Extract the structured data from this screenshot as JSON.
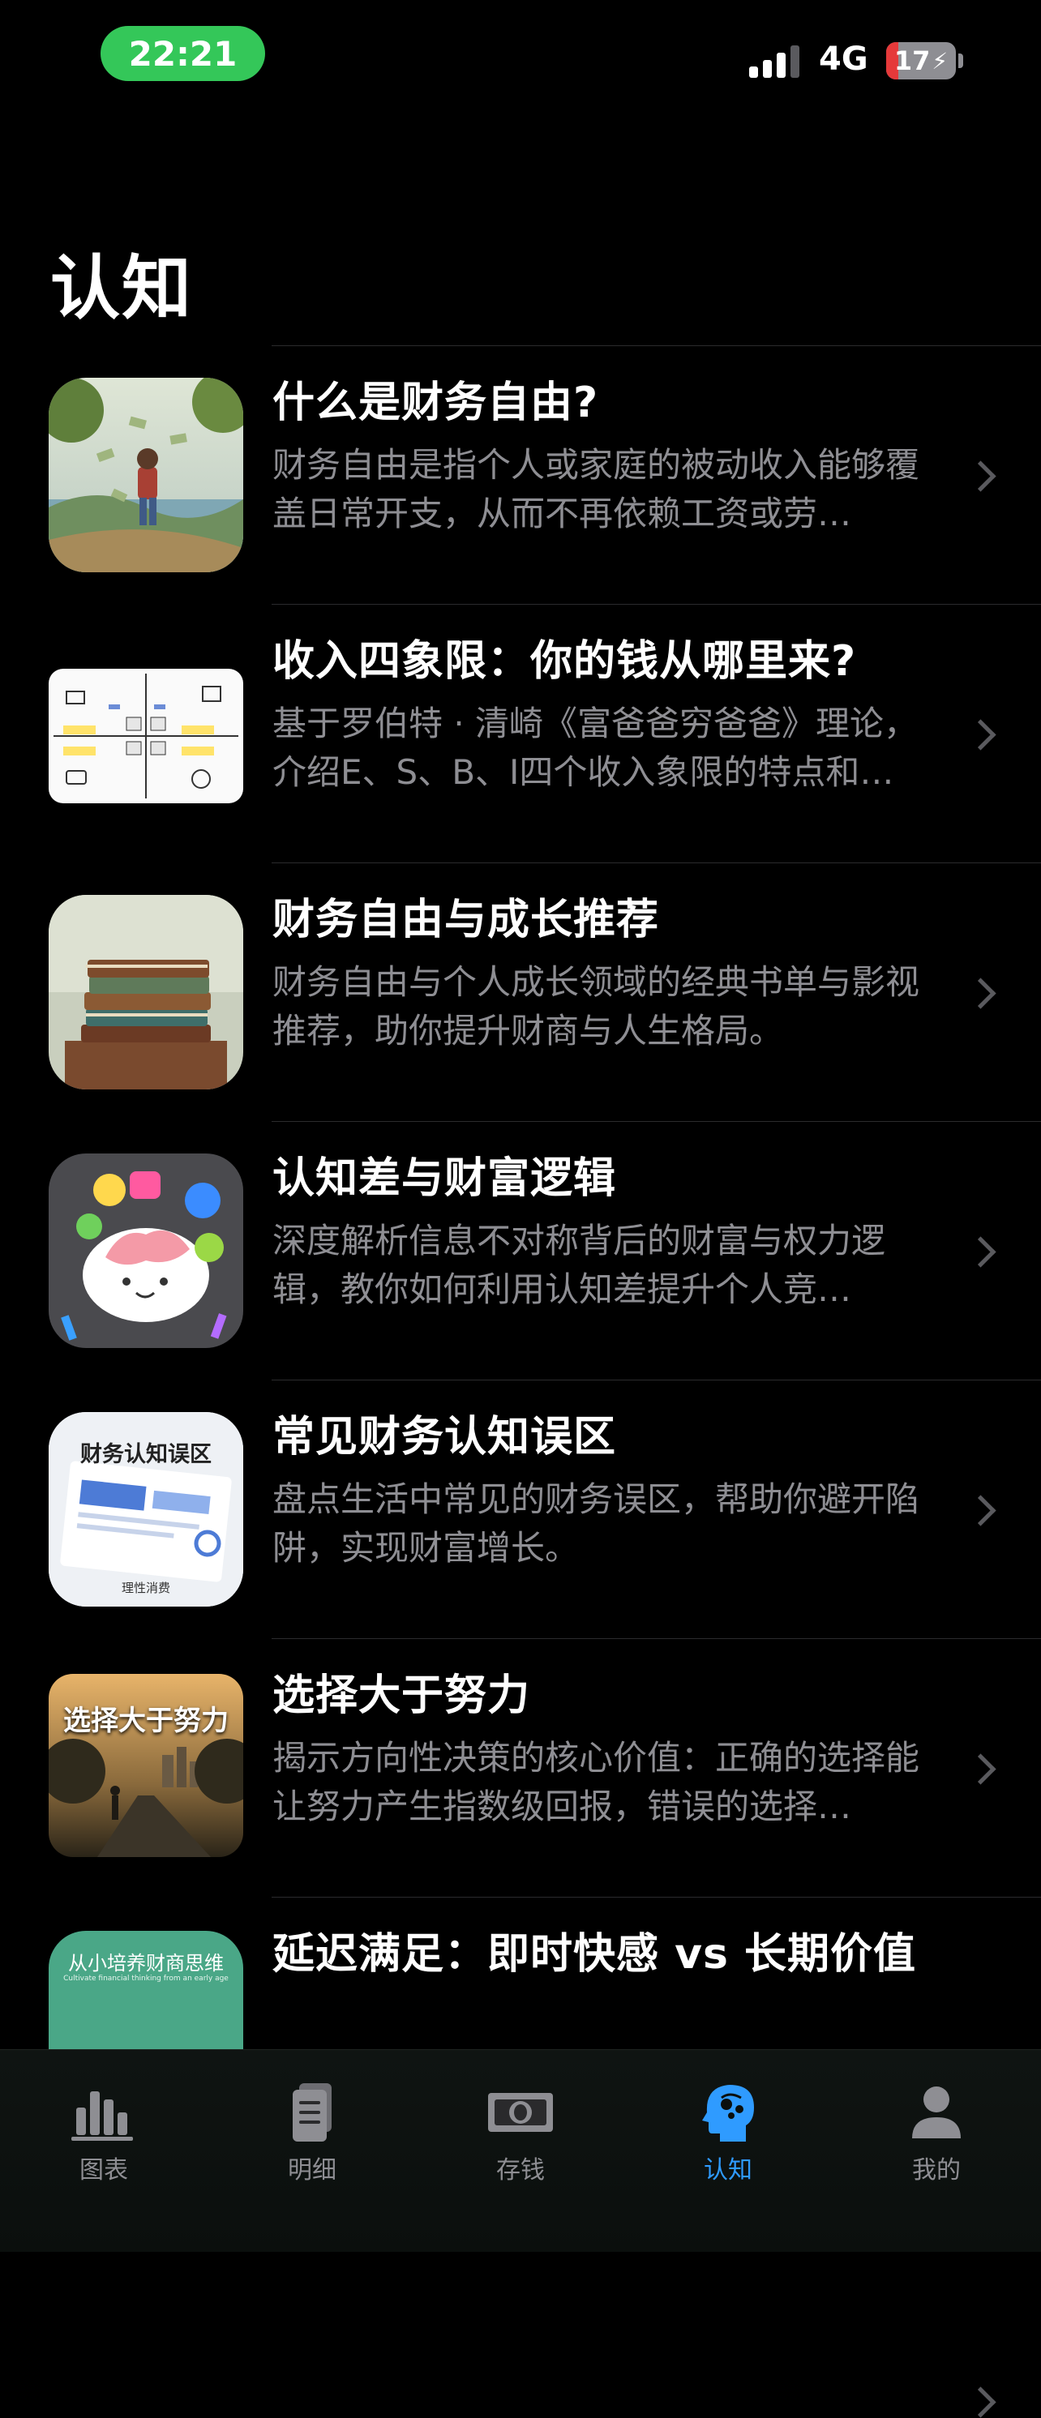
{
  "status_bar": {
    "time": "22:21",
    "network": "4G",
    "battery": "17",
    "battery_level": 0.17,
    "colors": {
      "time_pill": "#34C759",
      "battery_low": "#E5393A"
    }
  },
  "page": {
    "title": "认知"
  },
  "articles": [
    {
      "title": "什么是财务自由?",
      "description": "财务自由是指个人或家庭的被动收入能够覆盖日常开支，从而不再依赖工资或劳…",
      "thumbnail": "child-running-money-illustration"
    },
    {
      "title": "收入四象限：你的钱从哪里来?",
      "description": "基于罗伯特 · 清崎《富爸爸穷爸爸》理论，介绍E、S、B、I四个收入象限的特点和…",
      "thumbnail": "cashflow-quadrant-diagram"
    },
    {
      "title": "财务自由与成长推荐",
      "description": "财务自由与个人成长领域的经典书单与影视推荐，助你提升财商与人生格局。",
      "thumbnail": "stack-of-books-photo"
    },
    {
      "title": "认知差与财富逻辑",
      "description": "深度解析信息不对称背后的财富与权力逻辑，教你如何利用认知差提升个人竞…",
      "thumbnail": "cartoon-brain-illustration"
    },
    {
      "title": "常见财务认知误区",
      "description": "盘点生活中常见的财务误区，帮助你避开陷阱，实现财富增长。",
      "thumbnail": "finance-charts-card",
      "thumbnail_text": "财务认知误区",
      "thumbnail_sub": "理性消费"
    },
    {
      "title": "选择大于努力",
      "description": "揭示方向性决策的核心价值：正确的选择能让努力产生指数级回报，错误的选择…",
      "thumbnail": "road-sunset-silhouette",
      "thumbnail_text": "选择大于努力"
    },
    {
      "title": "延迟满足：即时快感 vs 长期价值",
      "description": "",
      "thumbnail": "green-card-illustration",
      "thumbnail_text": "从小培养财商思维",
      "thumbnail_sub": "Cultivate financial thinking from an early age"
    }
  ],
  "tab_bar": {
    "items": [
      {
        "label": "图表",
        "icon": "bar-chart-icon"
      },
      {
        "label": "明细",
        "icon": "document-list-icon"
      },
      {
        "label": "存钱",
        "icon": "banknote-icon"
      },
      {
        "label": "认知",
        "icon": "brain-head-icon"
      },
      {
        "label": "我的",
        "icon": "person-icon"
      }
    ],
    "active": "认知",
    "colors": {
      "active": "#2F9BFF",
      "inactive": "#8e8e93"
    }
  }
}
